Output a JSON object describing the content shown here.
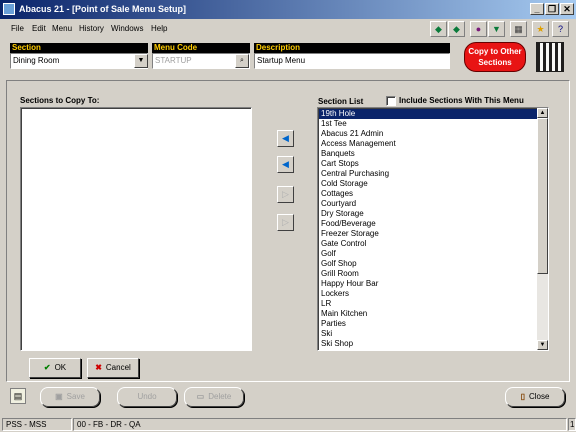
{
  "window": {
    "title": "Abacus 21 - [Point of Sale Menu Setup]",
    "minimize": "_",
    "restore": "❐",
    "close": "✕"
  },
  "menubar": {
    "items": [
      "File",
      "Edit",
      "Menu",
      "History",
      "Windows",
      "Help"
    ]
  },
  "toolbar_icons": [
    "arrow-left-icon",
    "arrow-right-icon",
    "gem-icon",
    "arrow-down-icon",
    "calculator-icon",
    "running-man-icon",
    "help-icon"
  ],
  "header": {
    "section_label": "Section",
    "section_value": "Dining Room",
    "menu_code_label": "Menu Code",
    "menu_code_value": "STARTUP",
    "description_label": "Description",
    "description_value": "Startup Menu",
    "copy_button": "Copy to Other Sections"
  },
  "copy_to": {
    "label": "Sections to Copy To:",
    "items": []
  },
  "section_list": {
    "label": "Section List",
    "include_label": "Include Sections With This Menu",
    "include_checked": false,
    "items": [
      "19th Hole",
      "1st Tee",
      "Abacus 21 Admin",
      "Access Management",
      "Banquets",
      "Cart Stops",
      "Central Purchasing",
      "Cold Storage",
      "Cottages",
      "Courtyard",
      "Dry Storage",
      "Food/Beverage",
      "Freezer Storage",
      "Gate Control",
      "Golf",
      "Golf Shop",
      "Grill Room",
      "Happy Hour Bar",
      "Lockers",
      "LR",
      "Main Kitchen",
      "Parties",
      "Ski",
      "Ski Shop"
    ],
    "selected_index": 0
  },
  "buttons": {
    "ok": "OK",
    "cancel": "Cancel",
    "save": "Save",
    "undo": "Undo",
    "delete": "Delete",
    "close": "Close"
  },
  "status": {
    "left": "PSS - MSS",
    "mid": "00 - FB - DR - QA",
    "right": "1"
  }
}
